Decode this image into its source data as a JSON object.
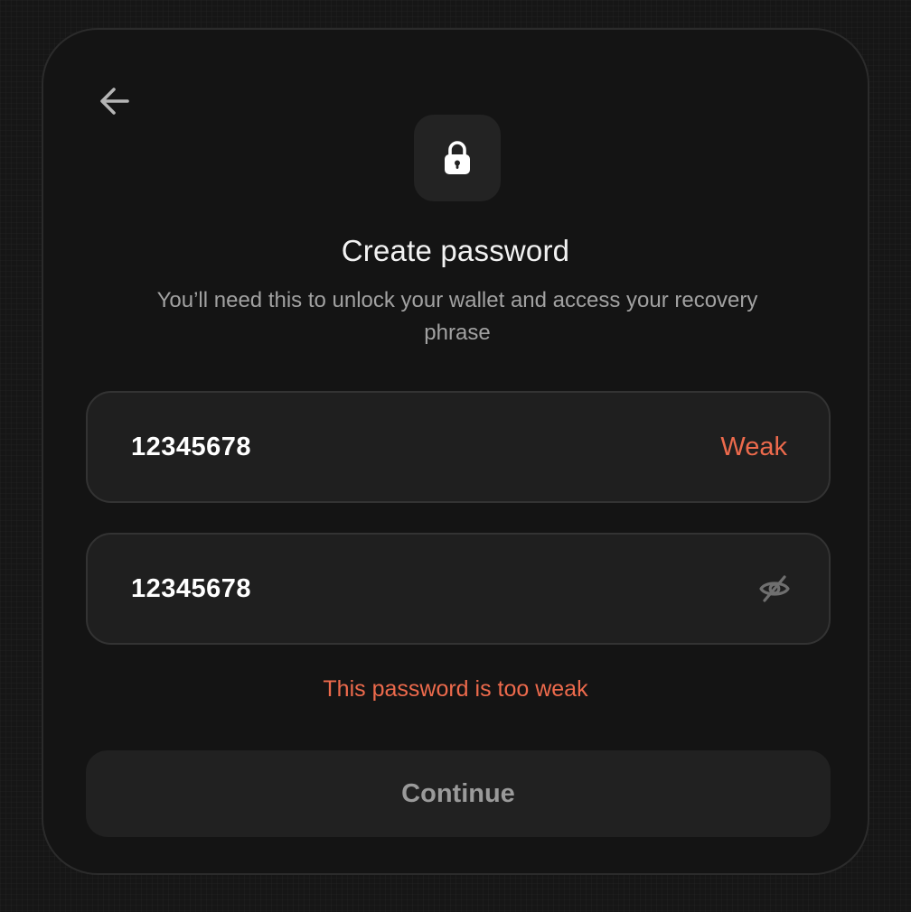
{
  "icons": {
    "back": "arrow-left-icon",
    "lock": "lock-icon",
    "visibility": "eye-off-icon"
  },
  "colors": {
    "background": "#161616",
    "card": "#141414",
    "field": "#1f1f1f",
    "error": "#ed6a4c",
    "button_text_disabled": "#9a9a9a"
  },
  "header": {
    "title": "Create password",
    "subtitle": "You’ll need this to unlock your wallet and access your recovery phrase"
  },
  "password_field": {
    "value": "12345678",
    "strength_label": "Weak"
  },
  "confirm_field": {
    "value": "12345678"
  },
  "error_message": "This password is too weak",
  "continue_button": {
    "label": "Continue",
    "state": "disabled"
  }
}
